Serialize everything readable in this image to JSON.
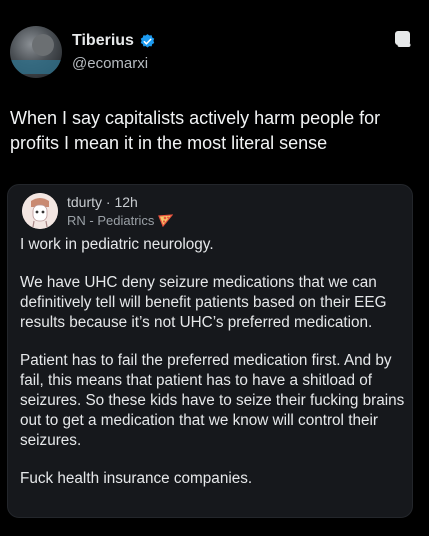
{
  "post": {
    "author": {
      "name": "Tiberius",
      "handle": "@ecomarxi"
    },
    "text": "When I say capitalists actively harm people for profits I mean it in the most literal sense"
  },
  "quote": {
    "username": "tdurty",
    "separator": "·",
    "time": "12h",
    "flair": "RN - Pediatrics",
    "paragraphs": [
      "I work in pediatric neurology.",
      "We have UHC deny seizure medications that we can definitively tell will benefit patients based on their EEG results because it’s not UHC’s preferred medication.",
      "Patient has to fail the preferred medication first. And by fail, this means that patient has to have a shitload of seizures. So these kids have to seize their fucking brains out to get a medication that we know will control their seizures.",
      "Fuck health insurance companies."
    ]
  },
  "colors": {
    "background": "#000000",
    "card": "#16181c",
    "verified": "#1d9bf0",
    "flair_badge": "#e8533f"
  },
  "icons": {
    "verified": "verified-badge-icon",
    "more": "more-options-icon",
    "flair": "pizza-flair-icon"
  }
}
